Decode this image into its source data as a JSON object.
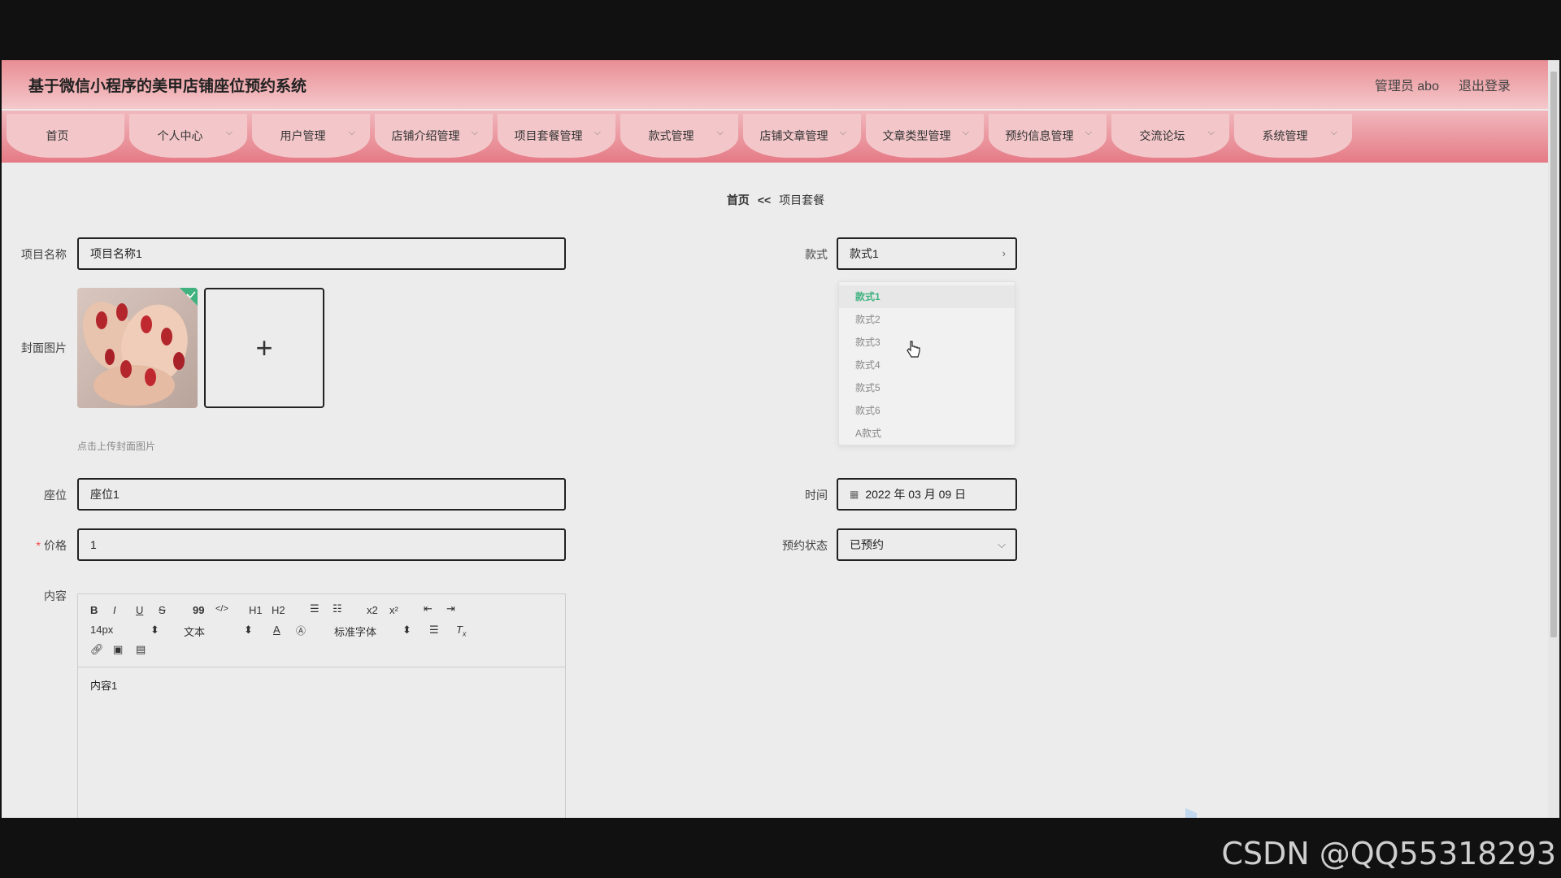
{
  "header": {
    "app_title": "基于微信小程序的美甲店铺座位预约系统",
    "user_label": "管理员 abo",
    "logout_label": "退出登录"
  },
  "nav": {
    "items": [
      {
        "label": "首页",
        "has_dropdown": false
      },
      {
        "label": "个人中心",
        "has_dropdown": true
      },
      {
        "label": "用户管理",
        "has_dropdown": true
      },
      {
        "label": "店铺介绍管理",
        "has_dropdown": true
      },
      {
        "label": "项目套餐管理",
        "has_dropdown": true
      },
      {
        "label": "款式管理",
        "has_dropdown": true
      },
      {
        "label": "店铺文章管理",
        "has_dropdown": true
      },
      {
        "label": "文章类型管理",
        "has_dropdown": true
      },
      {
        "label": "预约信息管理",
        "has_dropdown": true
      },
      {
        "label": "交流论坛",
        "has_dropdown": true
      },
      {
        "label": "系统管理",
        "has_dropdown": true
      }
    ]
  },
  "breadcrumb": {
    "home": "首页",
    "separator": "<<",
    "current": "项目套餐"
  },
  "form": {
    "project_name": {
      "label": "项目名称",
      "value": "项目名称1"
    },
    "style": {
      "label": "款式",
      "value": "款式1"
    },
    "cover": {
      "label": "封面图片",
      "hint": "点击上传封面图片",
      "upload_symbol": "+"
    },
    "style_options": [
      "款式1",
      "款式2",
      "款式3",
      "款式4",
      "款式5",
      "款式6",
      "A款式"
    ],
    "style_selected_index": 0,
    "seat": {
      "label": "座位",
      "value": "座位1"
    },
    "time": {
      "label": "时间",
      "value": "2022 年 03 月 09 日"
    },
    "price": {
      "label": "价格",
      "required_mark": "*",
      "value": "1"
    },
    "status": {
      "label": "预约状态",
      "value": "已预约"
    },
    "content": {
      "label": "内容",
      "value": "内容1"
    }
  },
  "editor_toolbar": {
    "font_size": "14px",
    "header_select": "文本",
    "font_family": "标准字体",
    "buttons": [
      "B",
      "I",
      "U",
      "S",
      "99",
      "</>",
      "H1",
      "H2",
      "ol",
      "ul",
      "x2",
      "x²"
    ]
  },
  "watermark": "CSDN @QQ55318293",
  "colors": {
    "nav_pink": "#f3c7ca",
    "header_pink": "#e98e95",
    "selected_green": "#3fb27f"
  }
}
